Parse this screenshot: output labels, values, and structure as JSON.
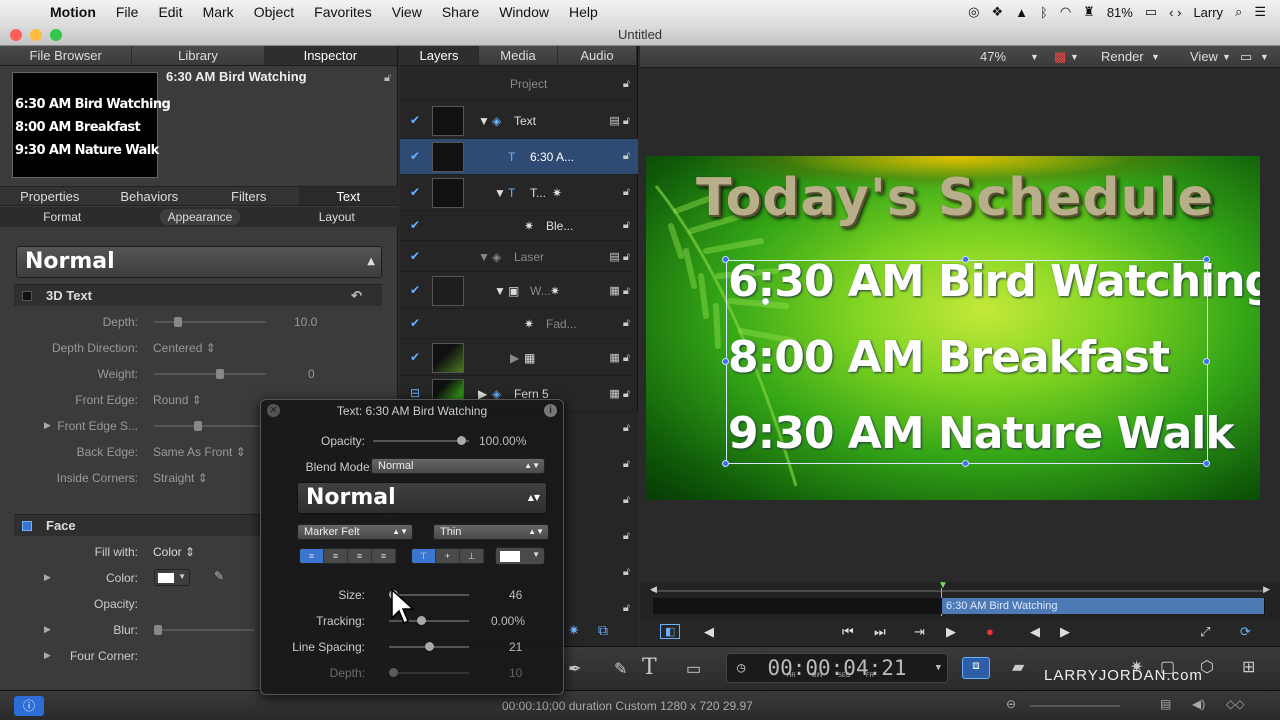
{
  "menubar": {
    "app": "Motion",
    "items": [
      "File",
      "Edit",
      "Mark",
      "Object",
      "Favorites",
      "View",
      "Share",
      "Window",
      "Help"
    ],
    "battery": "81%",
    "user": "Larry"
  },
  "window": {
    "title": "Untitled"
  },
  "left_tabs": [
    "File Browser",
    "Library",
    "Inspector"
  ],
  "inspector": {
    "title": "6:30 AM Bird Watching",
    "preview_lines": [
      "6:30 AM Bird Watching",
      "8:00 AM Breakfast",
      "9:30 AM Nature Walk"
    ],
    "tabs": [
      "Properties",
      "Behaviors",
      "Filters",
      "Text"
    ],
    "subtabs": [
      "Format",
      "Appearance",
      "Layout"
    ],
    "preset": "Normal",
    "group_3d": "3D Text",
    "rows_3d": [
      {
        "label": "Depth:",
        "value": "",
        "num": "10.0"
      },
      {
        "label": "Depth Direction:",
        "value": "Centered ⇕",
        "num": ""
      },
      {
        "label": "Weight:",
        "value": "",
        "num": "0"
      },
      {
        "label": "Front Edge:",
        "value": "Round ⇕",
        "num": ""
      },
      {
        "label": "Front Edge S...",
        "value": "",
        "num": ""
      },
      {
        "label": "Back Edge:",
        "value": "Same As Front ⇕",
        "num": ""
      },
      {
        "label": "Inside Corners:",
        "value": "Straight ⇕",
        "num": ""
      }
    ],
    "group_face": "Face",
    "rows_face": [
      {
        "label": "Fill with:",
        "value": "Color ⇕"
      },
      {
        "label": "Color:",
        "value": ""
      },
      {
        "label": "Opacity:",
        "value": ""
      },
      {
        "label": "Blur:",
        "value": ""
      },
      {
        "label": "Four Corner:",
        "value": ""
      }
    ]
  },
  "layers_tabs": [
    "Layers",
    "Media",
    "Audio"
  ],
  "layers": [
    {
      "name": "Project"
    },
    {
      "name": "Text"
    },
    {
      "name": "6:30 A..."
    },
    {
      "name": "T..."
    },
    {
      "name": "Ble..."
    },
    {
      "name": "Laser"
    },
    {
      "name": "W..."
    },
    {
      "name": "Fad..."
    },
    {
      "name": ""
    },
    {
      "name": "Fern 5"
    }
  ],
  "canvas": {
    "zoom": "47%",
    "render": "Render",
    "view": "View",
    "heading": "Today's Schedule",
    "lines": [
      "6:30 AM Bird Watching",
      "8:00 AM Breakfast",
      "9:30 AM Nature Walk"
    ]
  },
  "timeline": {
    "clip": "6:30 AM Bird Watching"
  },
  "timecode": "00:00:04:21",
  "timecode_units": [
    "HR",
    "MIN",
    "SEC",
    "FR"
  ],
  "watermark": "LARRYJORDAN.com",
  "status": "00:00:10;00 duration Custom 1280 x 720 29.97",
  "hud": {
    "title": "Text: 6:30 AM Bird Watching",
    "opacity_label": "Opacity:",
    "opacity_value": "100.00%",
    "blend_label": "Blend Mode:",
    "blend_value": "Normal",
    "preset": "Normal",
    "font": "Marker Felt",
    "weight": "Thin",
    "size_label": "Size:",
    "size_value": "46",
    "tracking_label": "Tracking:",
    "tracking_value": "0.00%",
    "spacing_label": "Line Spacing:",
    "spacing_value": "21",
    "depth_label": "Depth:",
    "depth_value": "10",
    "text_color": "#ffffff"
  },
  "colors": {
    "accent": "#3b75d0",
    "selection": "#2f4a73",
    "clip": "#4d79b4"
  }
}
